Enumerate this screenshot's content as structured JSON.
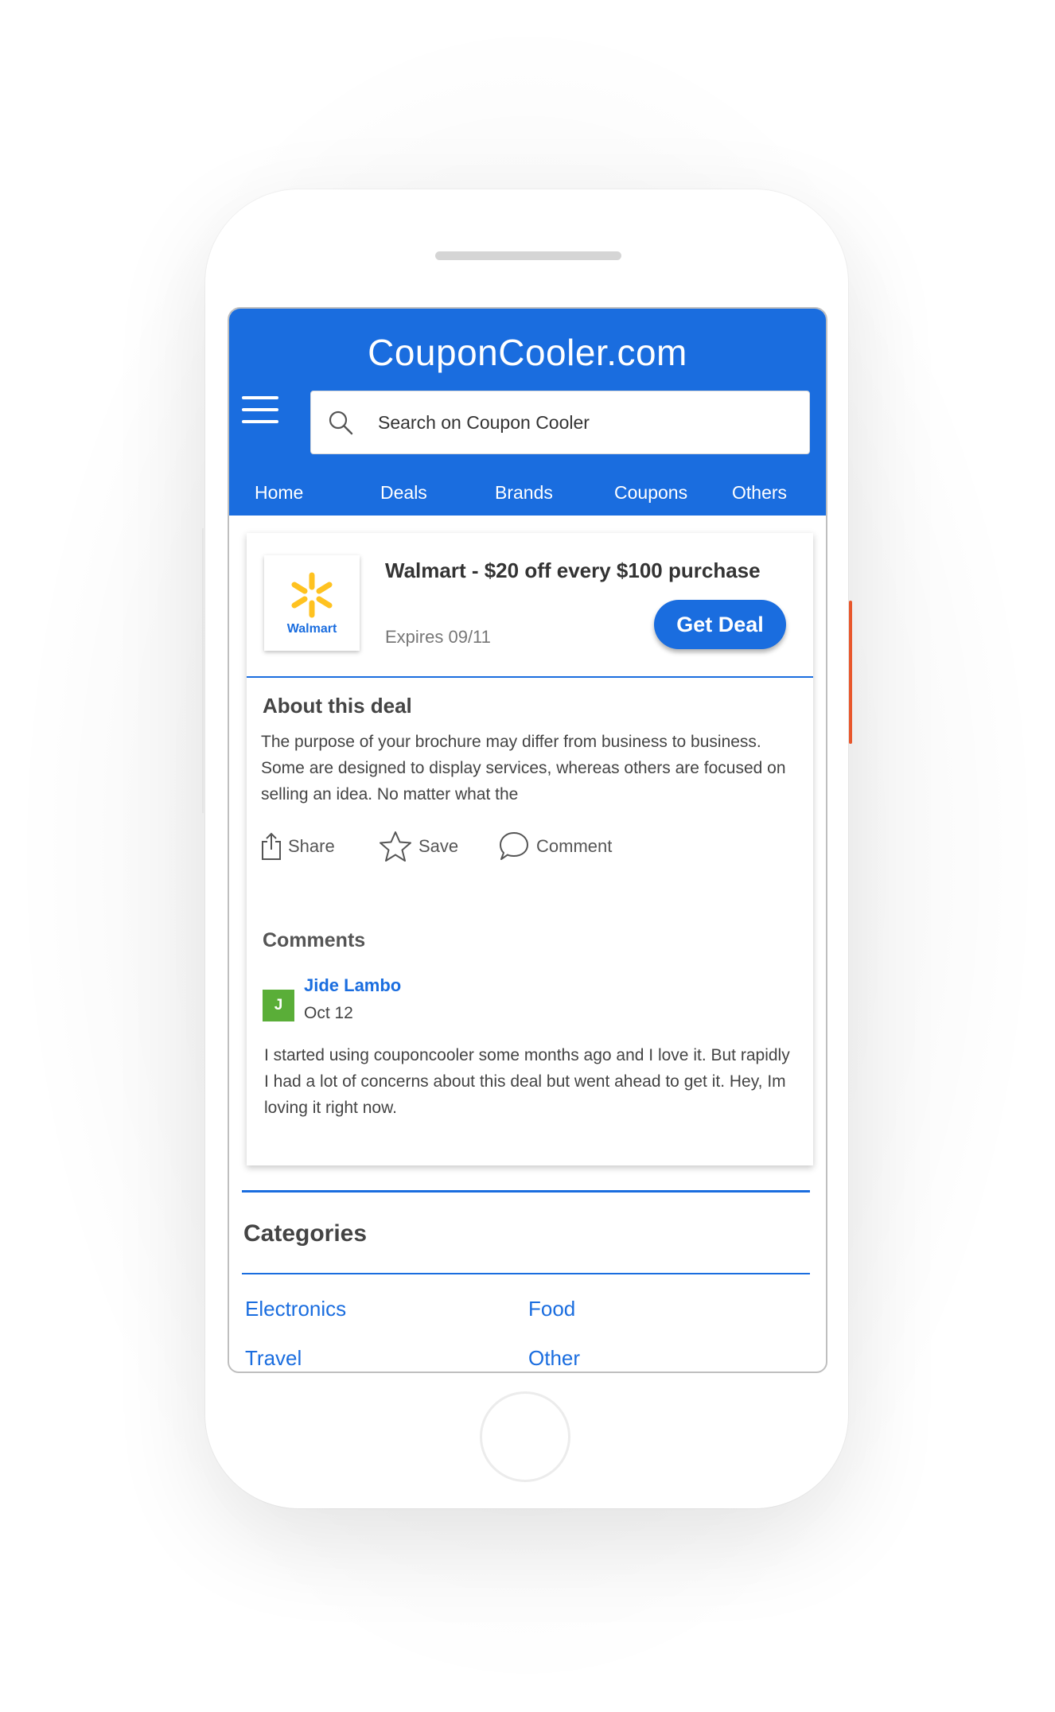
{
  "app": {
    "brand": "CouponCooler.com"
  },
  "search": {
    "placeholder": "Search on Coupon Cooler"
  },
  "nav": {
    "items": [
      "Home",
      "Deals",
      "Brands",
      "Coupons",
      "Others"
    ]
  },
  "deal": {
    "logo_text": "Walmart",
    "title": "Walmart - $20 off every $100 purchase",
    "expires": "Expires 09/11",
    "cta_label": "Get Deal"
  },
  "about": {
    "title": "About this deal",
    "text": "The purpose of your brochure may differ from business to business. Some are designed to display services, whereas others are focused on selling an idea. No matter what the"
  },
  "actions": {
    "share": "Share",
    "save": "Save",
    "comment": "Comment"
  },
  "comments": {
    "title": "Comments",
    "items": [
      {
        "avatar_initial": "J",
        "author": "Jide Lambo",
        "date": "Oct 12",
        "text": "I started using couponcooler some months ago and I love it. But rapidly I had a lot of concerns about this deal but went ahead to get it. Hey, Im loving it right now."
      }
    ]
  },
  "categories": {
    "title": "Categories",
    "items": [
      "Electronics",
      "Food",
      "Travel",
      "Other"
    ]
  },
  "colors": {
    "primary": "#1a6ddf",
    "avatar": "#5aae38",
    "walmart_yellow": "#ffc220",
    "side_button": "#e8572c"
  }
}
